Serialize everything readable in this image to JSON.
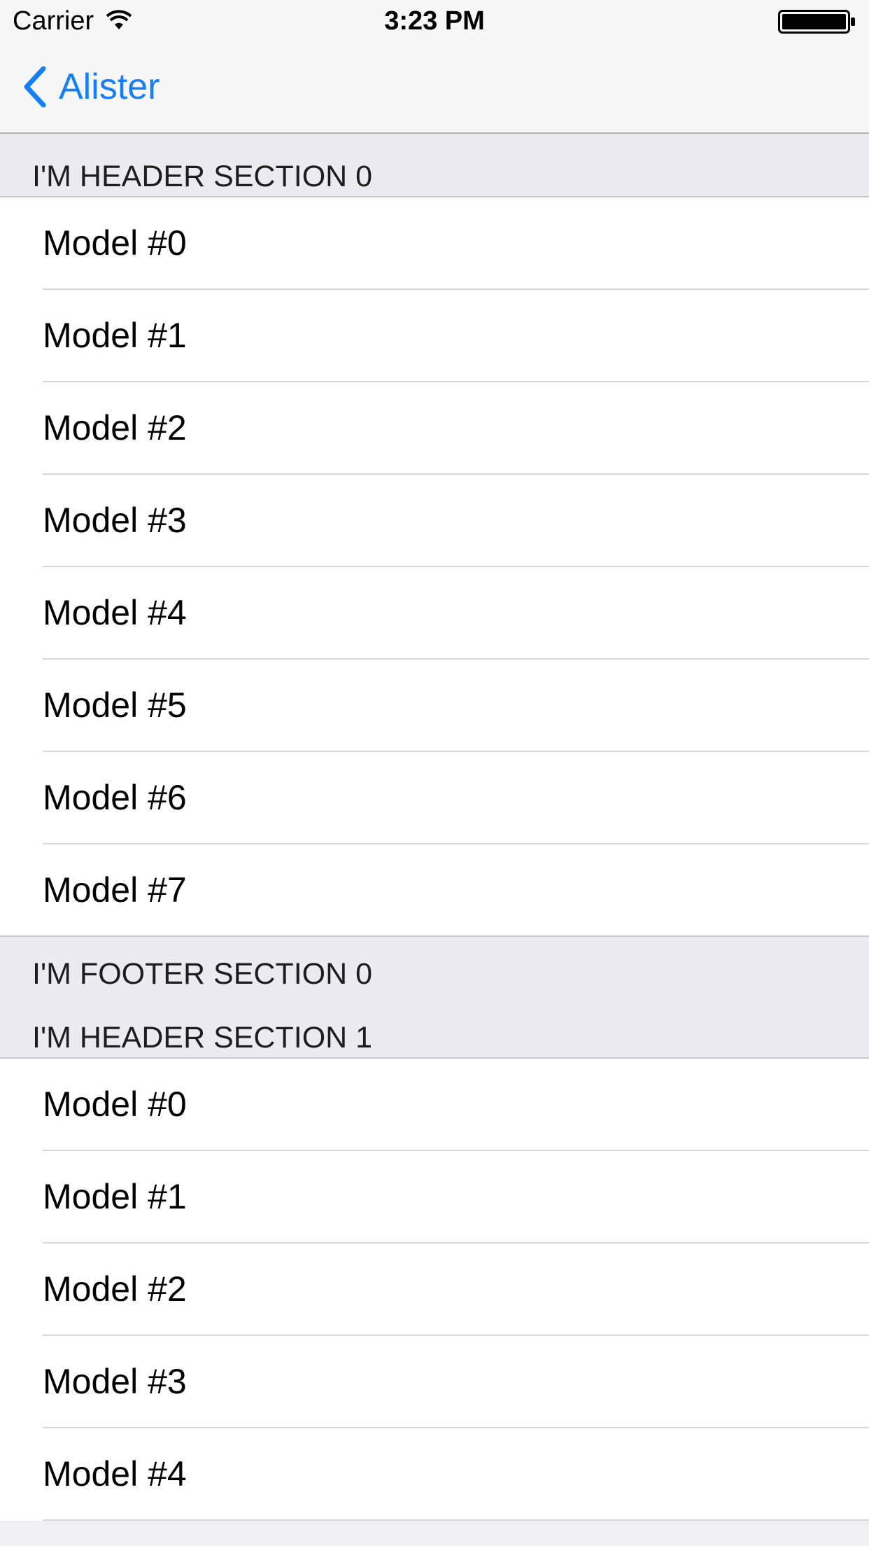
{
  "status_bar": {
    "carrier": "Carrier",
    "time": "3:23 PM",
    "wifi_icon": "wifi-icon",
    "battery_icon": "battery-icon"
  },
  "nav": {
    "back_label": "Alister",
    "back_icon": "chevron-left-icon",
    "tint_color": "#147efb"
  },
  "sections": [
    {
      "header": "I'M HEADER SECTION 0",
      "footer": "I'M FOOTER SECTION 0",
      "rows": [
        "Model #0",
        "Model #1",
        "Model #2",
        "Model #3",
        "Model #4",
        "Model #5",
        "Model #6",
        "Model #7"
      ]
    },
    {
      "header": "I'M HEADER SECTION 1",
      "rows": [
        "Model #0",
        "Model #1",
        "Model #2",
        "Model #3",
        "Model #4"
      ]
    }
  ]
}
